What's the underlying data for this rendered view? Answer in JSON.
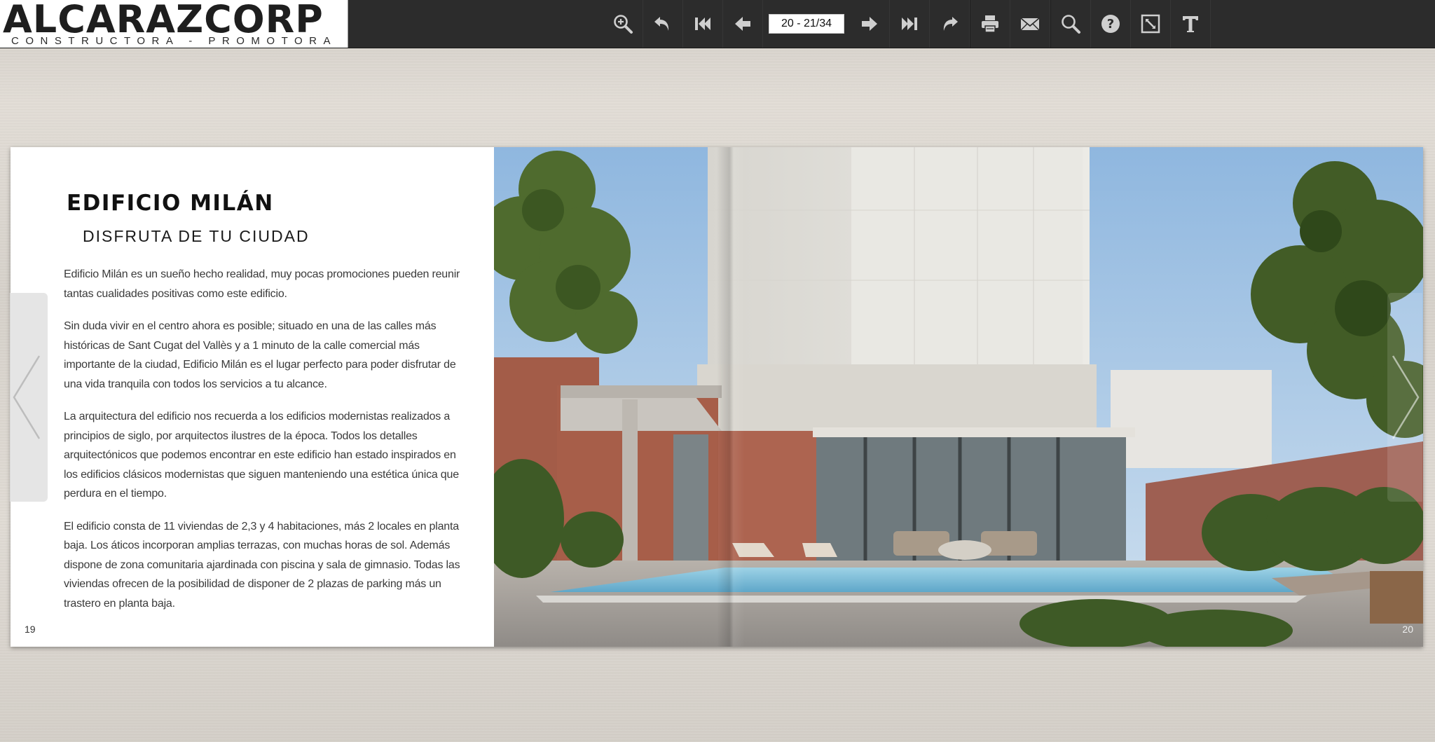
{
  "brand": {
    "name": "ALCARAZCORP",
    "tagline": "CONSTRUCTORA  -  PROMOTORA"
  },
  "toolbar": {
    "page_indicator": "20 - 21/34",
    "icons": [
      "zoom-in-icon",
      "undo-icon",
      "first-page-icon",
      "prev-page-icon",
      "next-page-icon",
      "last-page-icon",
      "redo-icon",
      "print-icon",
      "email-icon",
      "search-icon",
      "help-icon",
      "fullscreen-icon",
      "text-icon"
    ]
  },
  "page_left": {
    "title": "EDIFICIO MILÁN",
    "subtitle": "DISFRUTA DE TU CIUDAD",
    "paragraphs": [
      "Edificio Milán es un sueño hecho realidad, muy pocas promociones pueden reunir tantas cualidades positivas como este edificio.",
      "Sin duda vivir en el centro ahora es posible; situado en una de las calles más históricas de Sant Cugat del Vallès y a 1 minuto de la calle comercial más importante de la ciudad, Edificio Milán es el lugar perfecto para poder disfrutar de una vida tranquila con todos los servicios a tu alcance.",
      "La arquitectura del edificio nos recuerda a los edificios modernistas realizados a principios de siglo, por arquitectos ilustres de la época. Todos los detalles arquitectónicos que podemos encontrar en este edificio han estado inspirados en los edificios clásicos modernistas que siguen manteniendo una estética única que perdura en el tiempo.",
      "El edificio consta de 11 viviendas de 2,3 y 4 habitaciones, más 2 locales en planta baja. Los áticos incorporan amplias terrazas, con muchas horas de sol. Además dispone de zona comunitaria ajardinada con piscina y sala de gimnasio. Todas las viviendas ofrecen de la posibilidad de disponer de 2 plazas de parking más un trastero en planta baja."
    ],
    "page_number": "19"
  },
  "page_right": {
    "page_number": "20"
  },
  "colors": {
    "toolbar_bg": "#2c2c2c",
    "sky": "#a9c8e6",
    "brick": "#a35c48",
    "pool": "#6fb6d6"
  }
}
